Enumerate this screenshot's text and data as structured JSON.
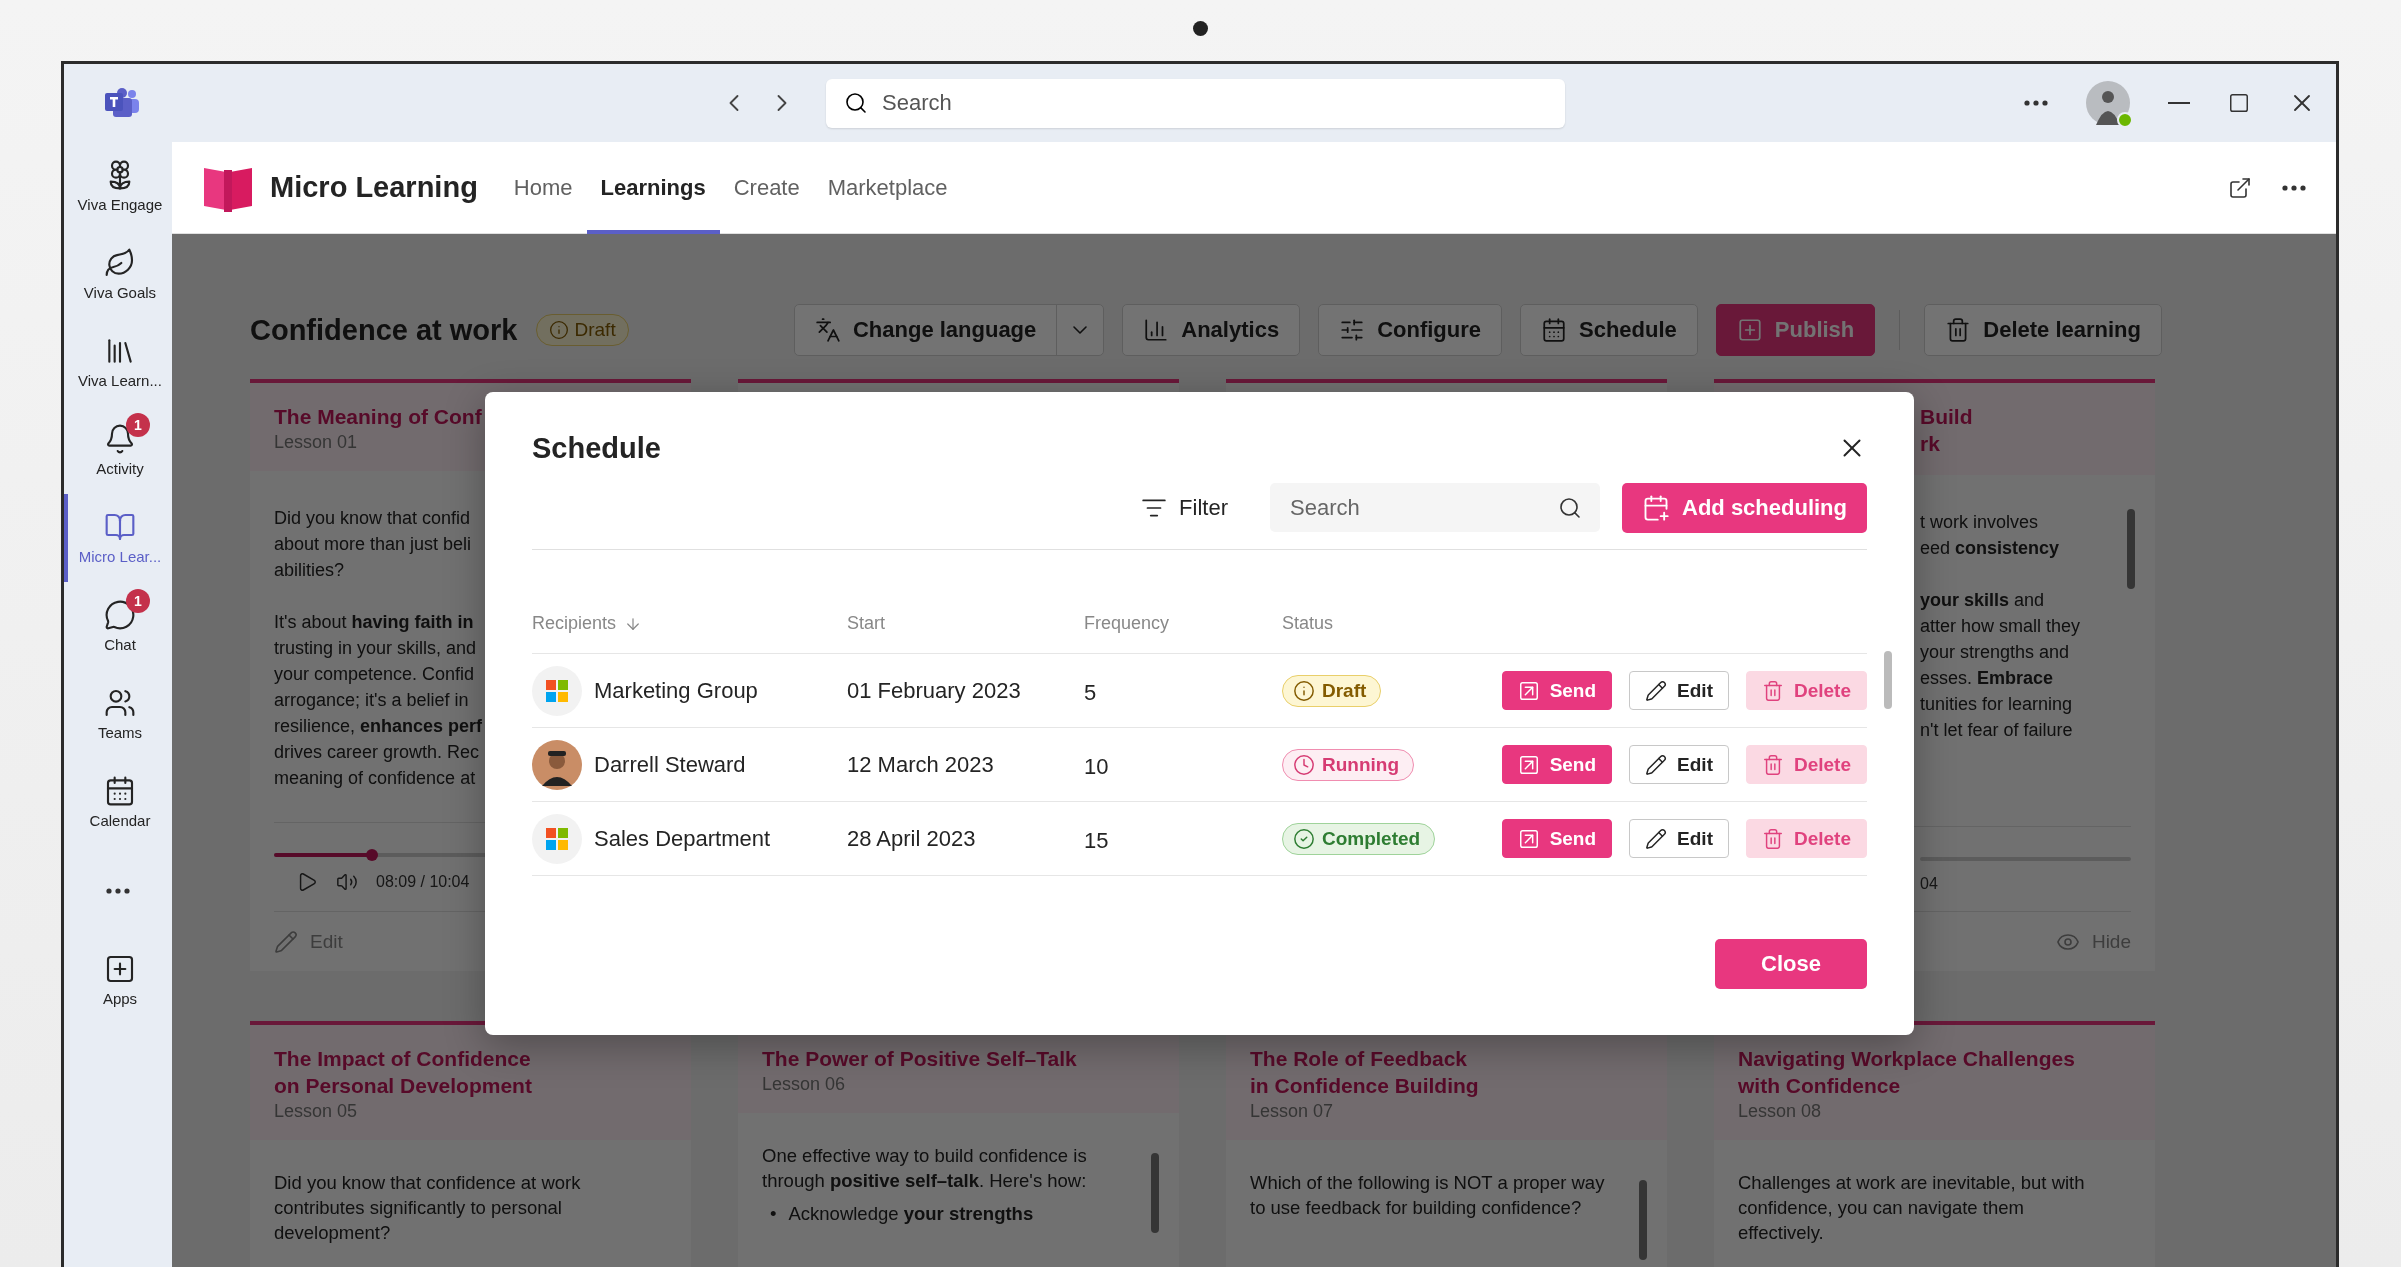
{
  "titlebar": {
    "search_placeholder": "Search"
  },
  "rail": {
    "items": [
      {
        "label": "Viva Engage",
        "selected": false
      },
      {
        "label": "Viva Goals",
        "selected": false
      },
      {
        "label": "Viva Learn...",
        "selected": false
      },
      {
        "label": "Activity",
        "selected": false,
        "badge": "1"
      },
      {
        "label": "Micro Lear...",
        "selected": true
      },
      {
        "label": "Chat",
        "selected": false,
        "badge": "1"
      },
      {
        "label": "Teams",
        "selected": false
      },
      {
        "label": "Calendar",
        "selected": false
      }
    ],
    "apps": {
      "label": "Apps"
    }
  },
  "app": {
    "name": "Micro Learning",
    "tabs": [
      {
        "label": "Home",
        "selected": false
      },
      {
        "label": "Learnings",
        "selected": true
      },
      {
        "label": "Create",
        "selected": false
      },
      {
        "label": "Marketplace",
        "selected": false
      }
    ]
  },
  "page": {
    "title": "Confidence at work",
    "status": "Draft",
    "actions": [
      {
        "label": "Change language",
        "kind": "split"
      },
      {
        "label": "Analytics",
        "kind": "plain"
      },
      {
        "label": "Configure",
        "kind": "plain"
      },
      {
        "label": "Schedule",
        "kind": "plain"
      },
      {
        "label": "Publish",
        "kind": "primary"
      },
      {
        "label": "Delete learning",
        "kind": "plain"
      }
    ]
  },
  "top_cards": [
    {
      "kind": "left_visible",
      "title": [
        "The Meaning of Conf"
      ],
      "lesson": "Lesson 01",
      "paragraphs": [
        [
          "Did you know that confid",
          "about more than just beli",
          "abilities?"
        ],
        [
          "It's about **having faith in**",
          "trusting in your skills, and",
          "your competence. Confid",
          "arrogance; it's a belief in",
          "resilience, **enhances perf**",
          "drives career growth. Rec",
          "meaning of confidence at"
        ]
      ],
      "time": "08:09 / 10:04",
      "level": 0.25,
      "footer": "Edit"
    },
    {
      "kind": "covered"
    },
    {
      "kind": "covered"
    },
    {
      "kind": "right_visible",
      "title": [
        "Build",
        "rk"
      ],
      "paragraphs": [
        [
          "t work involves",
          "eed **consistency**"
        ],
        [
          "**your skills** and",
          "atter how small they",
          "your strengths and",
          "esses. **Embrace**",
          "tunities for learning",
          "n't let fear of failure"
        ]
      ],
      "time": "04",
      "footer": "Hide"
    }
  ],
  "bottom_cards": [
    {
      "title": [
        "The Impact of Confidence",
        "on Personal Development"
      ],
      "lesson": "Lesson 05",
      "lines": [
        "Did you know that confidence at work",
        "contributes significantly to personal",
        "development?"
      ]
    },
    {
      "title": [
        "The Power of Positive Self–Talk"
      ],
      "lesson": "Lesson 06",
      "lines": [
        "One effective way to build confidence is",
        "through **positive self–talk**. Here's how:"
      ],
      "bullets": [
        {
          "marker": "•",
          "text": "Acknowledge **your strengths**"
        }
      ]
    },
    {
      "title": [
        "The Role of Feedback",
        "in Confidence Building"
      ],
      "lesson": "Lesson 07",
      "lines": [
        "Which of the following is NOT a proper way",
        "to use feedback for building confidence?"
      ]
    },
    {
      "title": [
        "Navigating Workplace Challenges",
        "with Confidence"
      ],
      "lesson": "Lesson 08",
      "lines": [
        "Challenges at work are inevitable, but with",
        "confidence, you can navigate them",
        "effectively."
      ]
    }
  ],
  "dialog": {
    "title": "Schedule",
    "filter": "Filter",
    "search_placeholder": "Search",
    "add": "Add scheduling",
    "columns": [
      {
        "label": "Recipients",
        "sorted": true
      },
      {
        "label": "Start",
        "sorted": false
      },
      {
        "label": "Frequency",
        "sorted": false
      },
      {
        "label": "Status",
        "sorted": false
      }
    ],
    "rows": [
      {
        "recipient": "Marketing Group",
        "kind": "group",
        "start": "01 February 2023",
        "frequency": "5",
        "status": {
          "label": "Draft",
          "kind": "draft"
        },
        "actions": [
          "Send",
          "Edit",
          "Delete"
        ]
      },
      {
        "recipient": "Darrell Steward",
        "kind": "person",
        "start": "12 March 2023",
        "frequency": "10",
        "status": {
          "label": "Running",
          "kind": "running"
        },
        "actions": [
          "Send",
          "Edit",
          "Delete"
        ]
      },
      {
        "recipient": "Sales Department",
        "kind": "group",
        "start": "28 April 2023",
        "frequency": "15",
        "status": {
          "label": "Completed",
          "kind": "completed"
        },
        "actions": [
          "Send",
          "Edit",
          "Delete"
        ]
      }
    ],
    "close": "Close"
  }
}
